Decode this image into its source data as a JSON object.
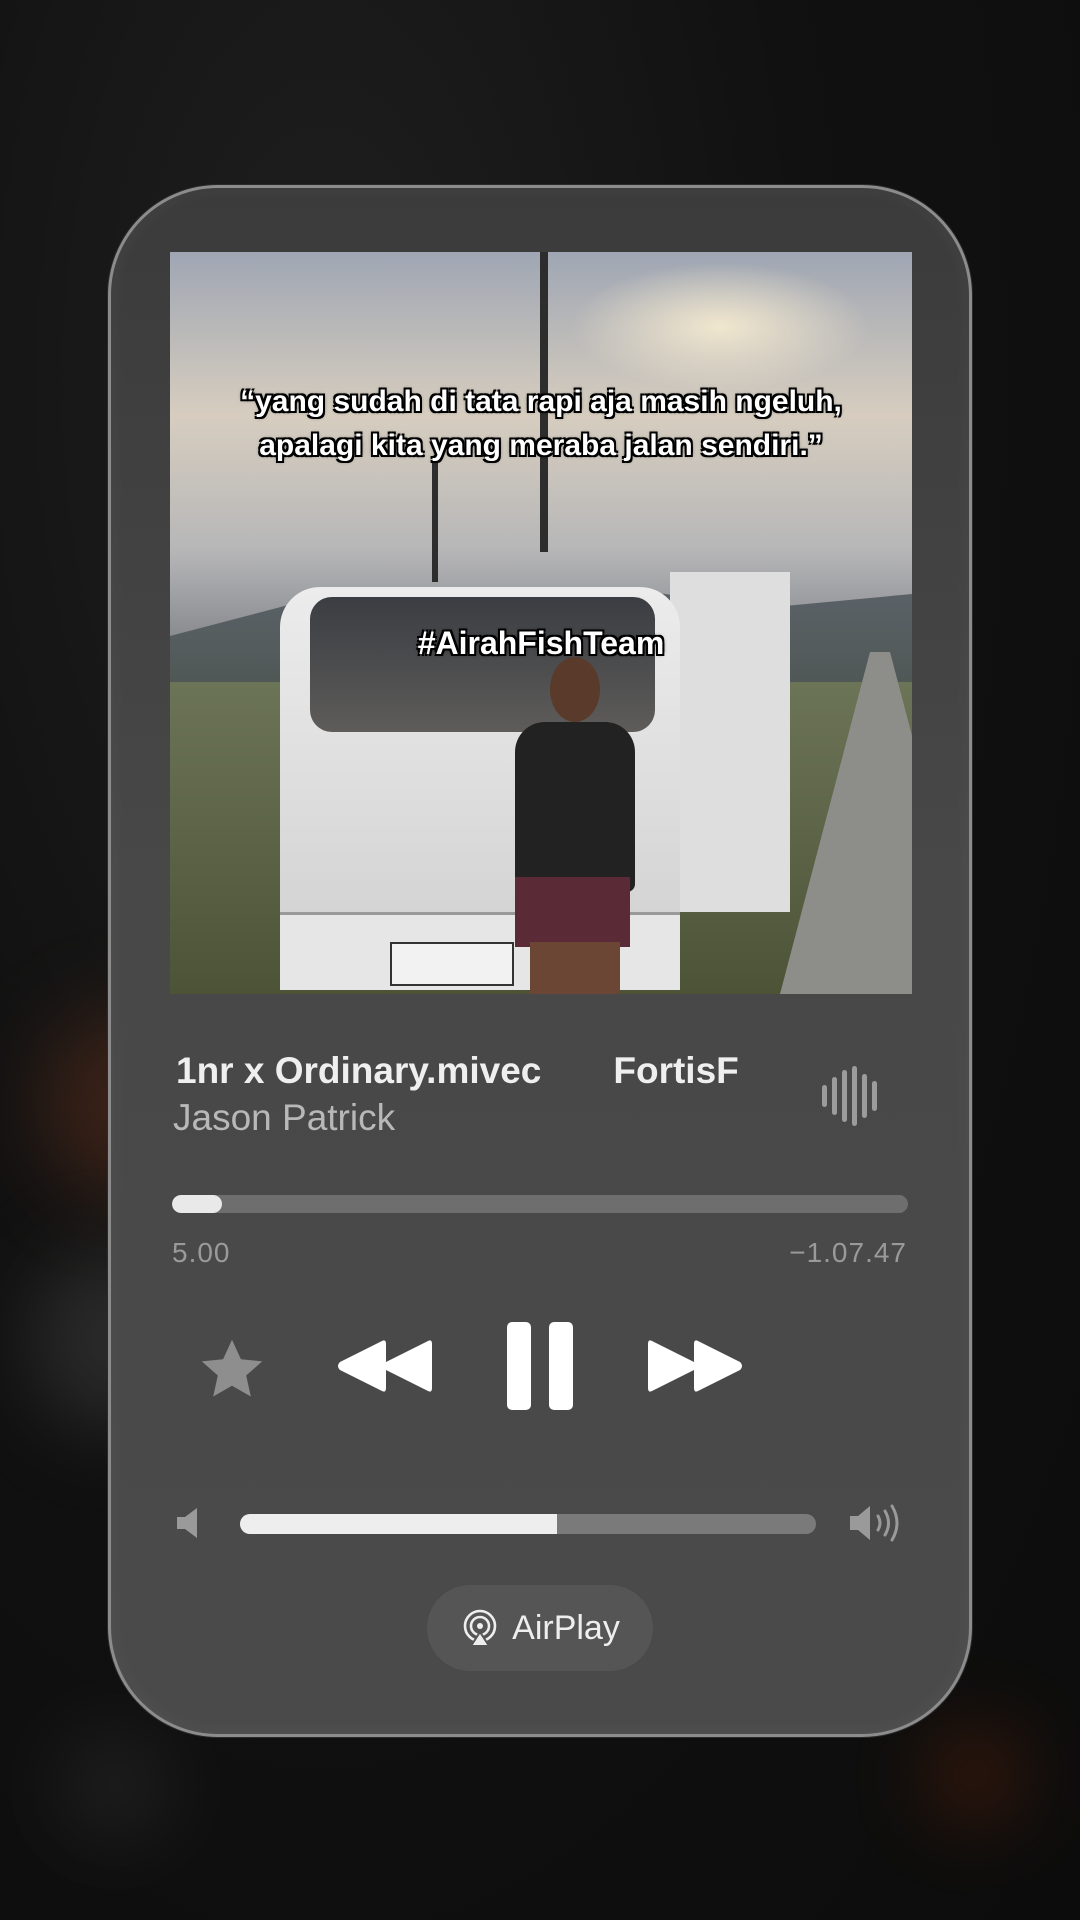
{
  "player": {
    "artwork": {
      "quote": "“yang sudah di tata rapi aja masih ngeluh, apalagi kita yang meraba jalan sendiri.”",
      "hashtag": "#AirahFishTeam"
    },
    "track": {
      "title": "1nr x Ordinary.mivec",
      "title_scroll_next": "FortisF",
      "artist": "Jason Patrick"
    },
    "progress": {
      "elapsed": "5.00",
      "remaining": "−1.07.47",
      "fraction": 0.068
    },
    "controls": {
      "favorite_icon": "star-icon",
      "rewind_icon": "rewind-icon",
      "pause_icon": "pause-icon",
      "forward_icon": "fast-forward-icon"
    },
    "volume": {
      "level": 0.55
    },
    "airplay": {
      "label": "AirPlay",
      "icon": "airplay-icon"
    },
    "colors": {
      "accent": "#eeeeee",
      "track": "#6e6e6e",
      "card": "#444444"
    }
  }
}
